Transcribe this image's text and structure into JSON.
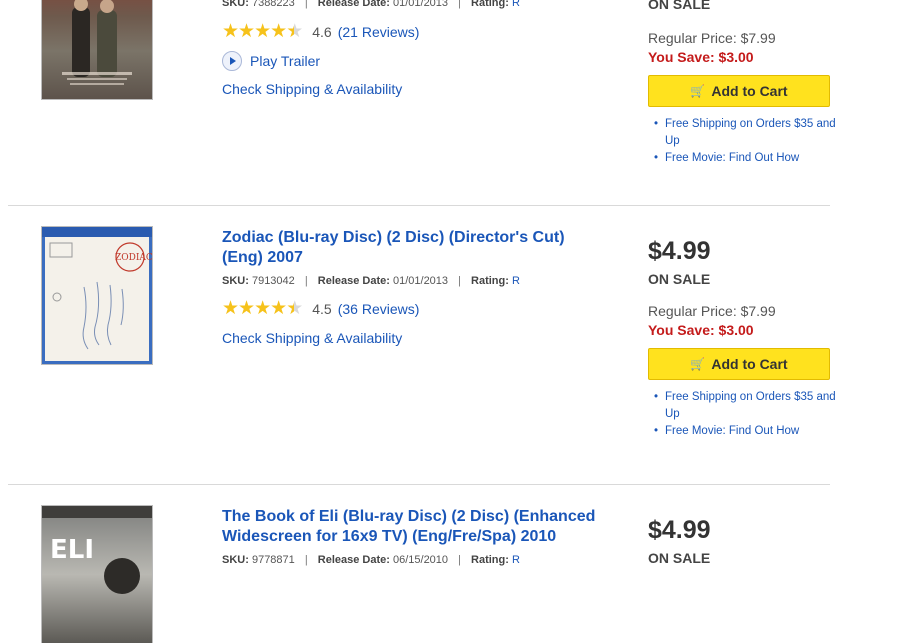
{
  "products": [
    {
      "sku_label": "SKU:",
      "sku": "7388223",
      "release_label": "Release Date:",
      "release": "01/01/2013",
      "rating_label": "Rating:",
      "rating": "R",
      "avg": "4.6",
      "reviews": "(21 Reviews)",
      "stars": 4.6,
      "trailer": "Play Trailer",
      "shipping_link": "Check Shipping & Availability",
      "onsale": "ON SALE",
      "regular": "Regular Price: $7.99",
      "save": "You Save: $3.00",
      "cart": "Add to Cart",
      "bullet1": "Free Shipping on Orders $35 and Up",
      "bullet2": "Free Movie: Find Out How"
    },
    {
      "title": "Zodiac (Blu-ray Disc) (2 Disc) (Director's Cut) (Eng) 2007",
      "sku_label": "SKU:",
      "sku": "7913042",
      "release_label": "Release Date:",
      "release": "01/01/2013",
      "rating_label": "Rating:",
      "rating": "R",
      "avg": "4.5",
      "reviews": "(36 Reviews)",
      "stars": 4.5,
      "shipping_link": "Check Shipping & Availability",
      "price": "$4.99",
      "onsale": "ON SALE",
      "regular": "Regular Price: $7.99",
      "save": "You Save: $3.00",
      "cart": "Add to Cart",
      "bullet1": "Free Shipping on Orders $35 and Up",
      "bullet2": "Free Movie: Find Out How",
      "thumb_text": "ZODIAC"
    },
    {
      "title": "The Book of Eli (Blu-ray Disc) (2 Disc) (Enhanced Widescreen for 16x9 TV) (Eng/Fre/Spa) 2010",
      "sku_label": "SKU:",
      "sku": "9778871",
      "release_label": "Release Date:",
      "release": "06/15/2010",
      "rating_label": "Rating:",
      "rating": "R",
      "price": "$4.99",
      "onsale": "ON SALE",
      "thumb_text": "ELI"
    }
  ],
  "icons": {
    "star": "star-icon",
    "play": "play-icon",
    "cart": "shopping-cart-icon"
  },
  "colors": {
    "link": "#1a56b8",
    "save": "#c41b1b",
    "cart_button": "#ffe21e",
    "star": "#f6c21b"
  }
}
